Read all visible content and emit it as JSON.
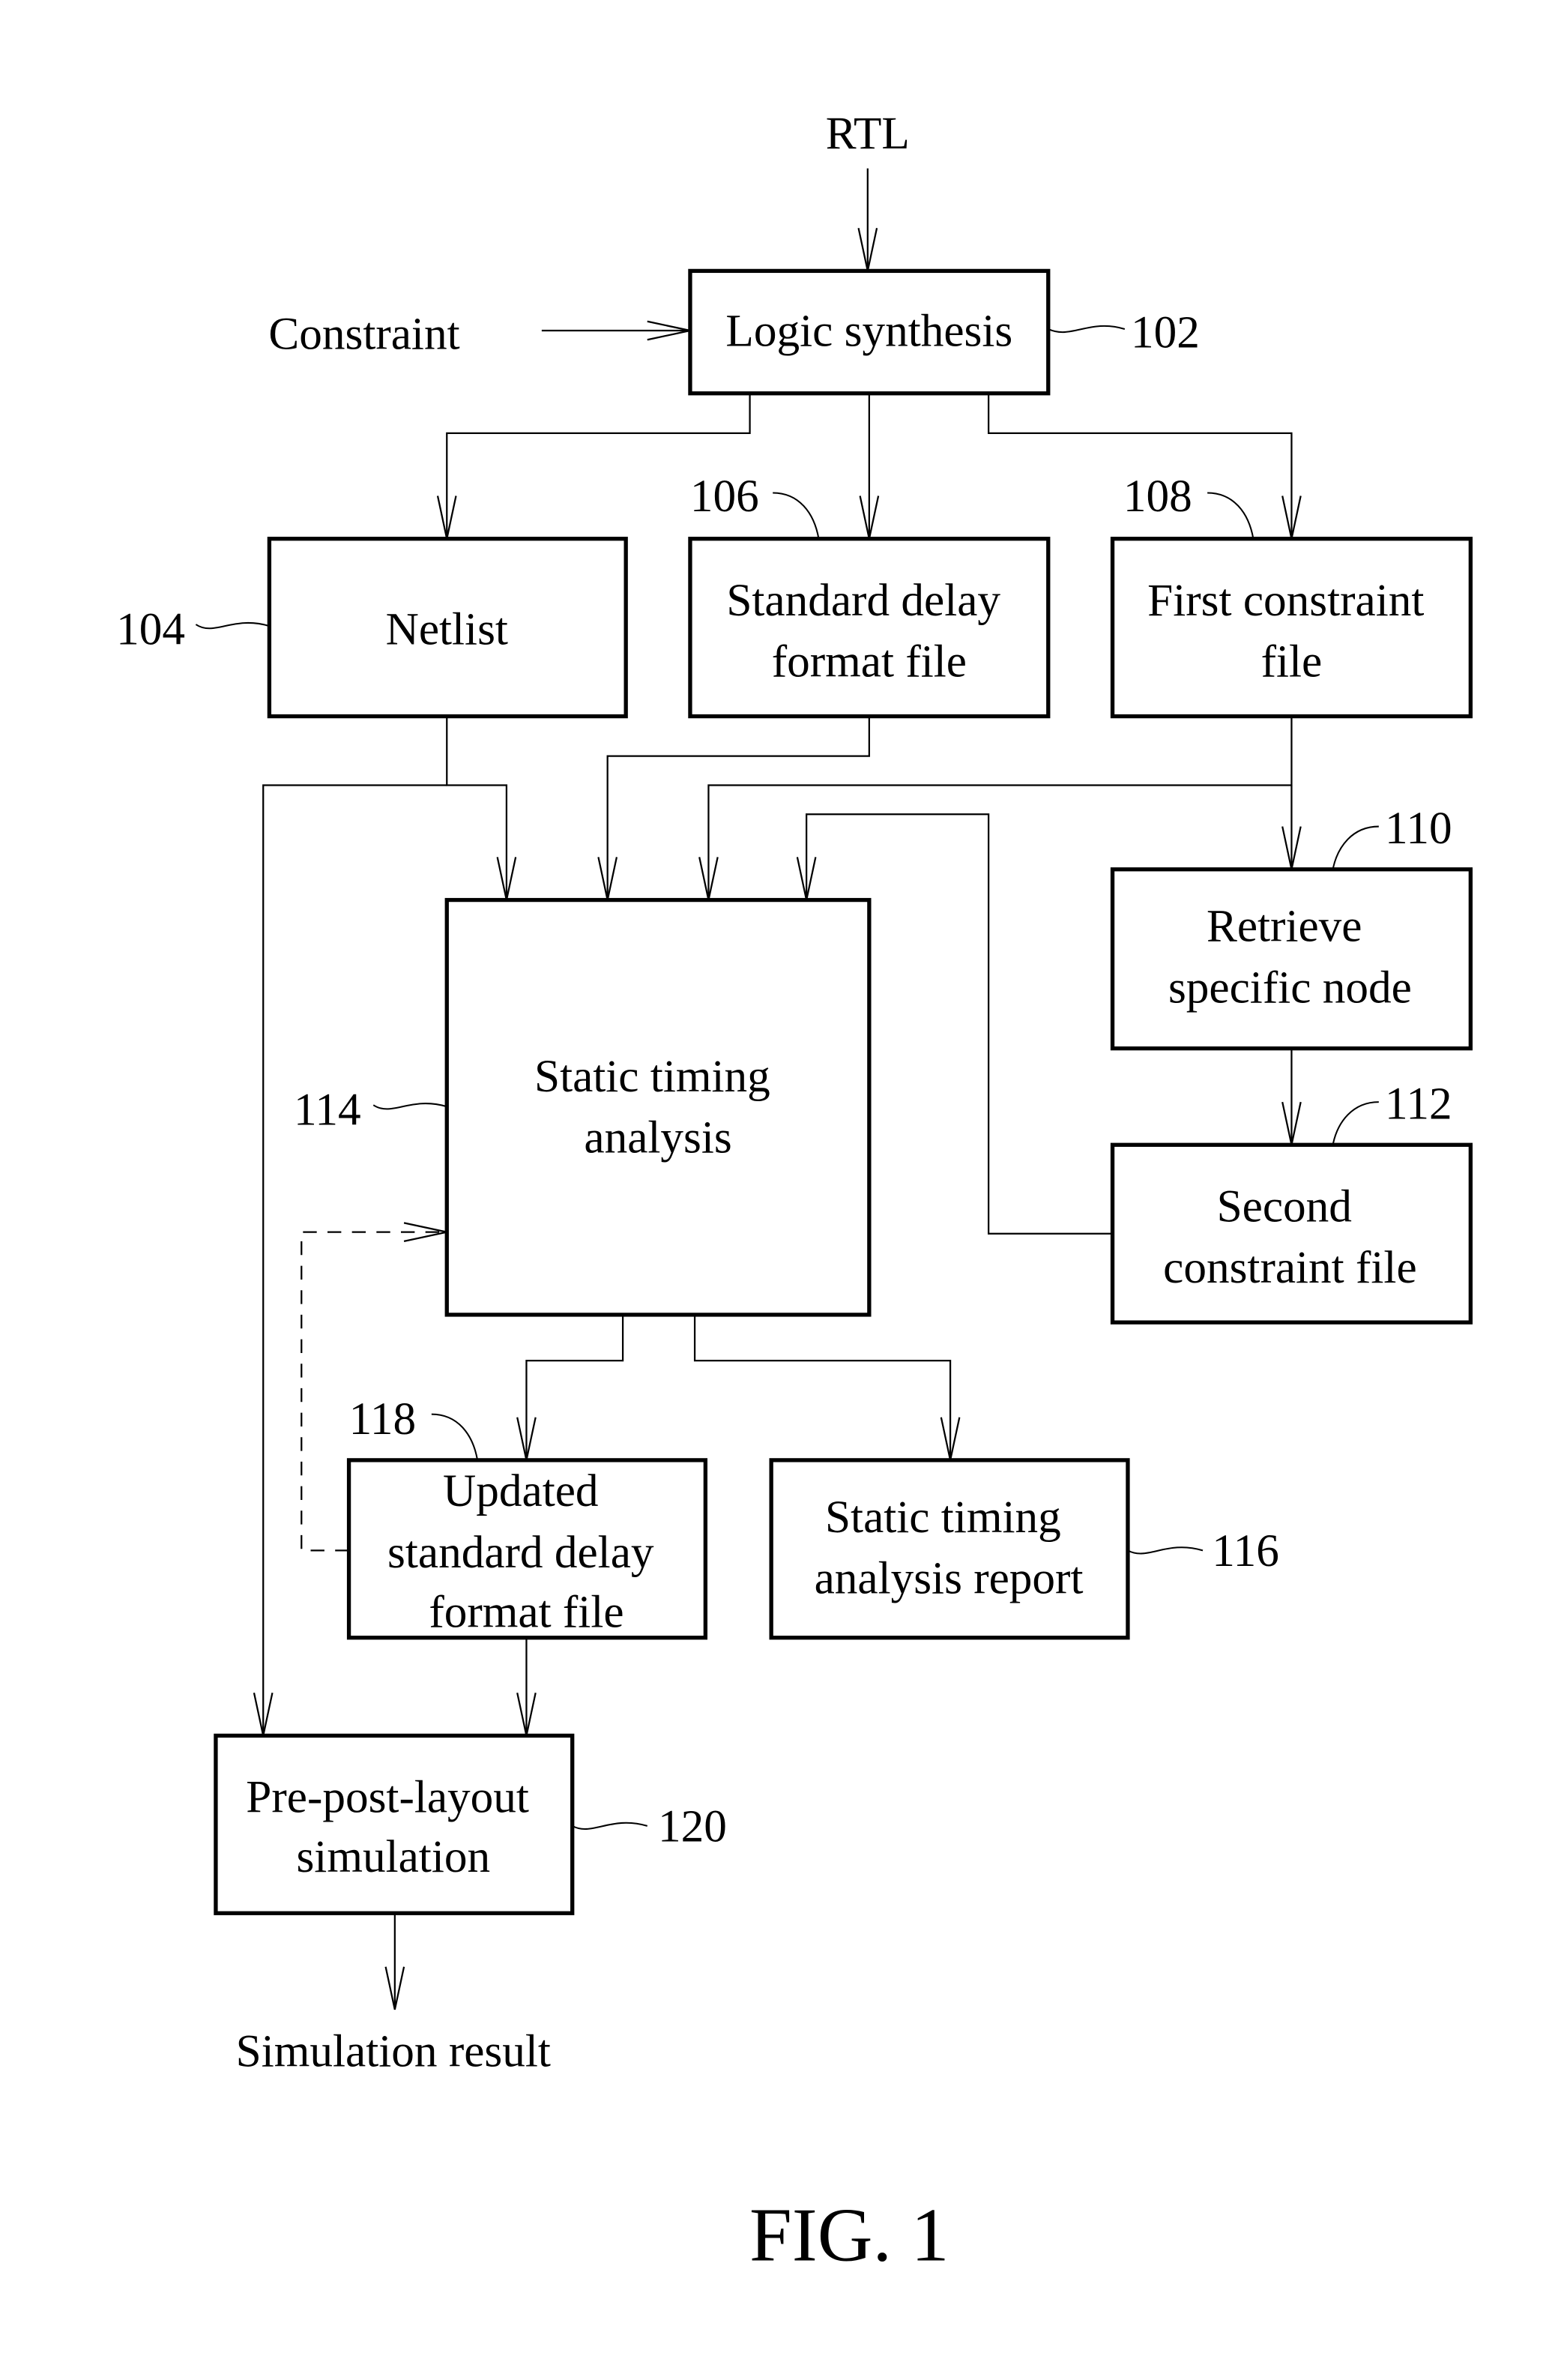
{
  "figure": {
    "caption": "FIG. 1"
  },
  "inputs": {
    "rtl": "RTL",
    "constraint": "Constraint"
  },
  "outputs": {
    "simulation_result": "Simulation result"
  },
  "blocks": {
    "logic_synthesis": {
      "ref": "102",
      "lines": [
        "Logic synthesis"
      ]
    },
    "netlist": {
      "ref": "104",
      "lines": [
        "Netlist"
      ]
    },
    "sdf_file": {
      "ref": "106",
      "lines": [
        "Standard delay",
        "format file"
      ]
    },
    "first_constraint": {
      "ref": "108",
      "lines": [
        "First constraint",
        "file"
      ]
    },
    "retrieve_node": {
      "ref": "110",
      "lines": [
        "Retrieve",
        "specific node"
      ]
    },
    "second_constraint": {
      "ref": "112",
      "lines": [
        "Second",
        "constraint file"
      ]
    },
    "sta": {
      "ref": "114",
      "lines": [
        "Static timing",
        "analysis"
      ]
    },
    "sta_report": {
      "ref": "116",
      "lines": [
        "Static timing",
        "analysis report"
      ]
    },
    "updated_sdf": {
      "ref": "118",
      "lines": [
        "Updated",
        "standard delay",
        "format file"
      ]
    },
    "simulation": {
      "ref": "120",
      "lines": [
        "Pre-post-layout",
        "simulation"
      ]
    }
  }
}
